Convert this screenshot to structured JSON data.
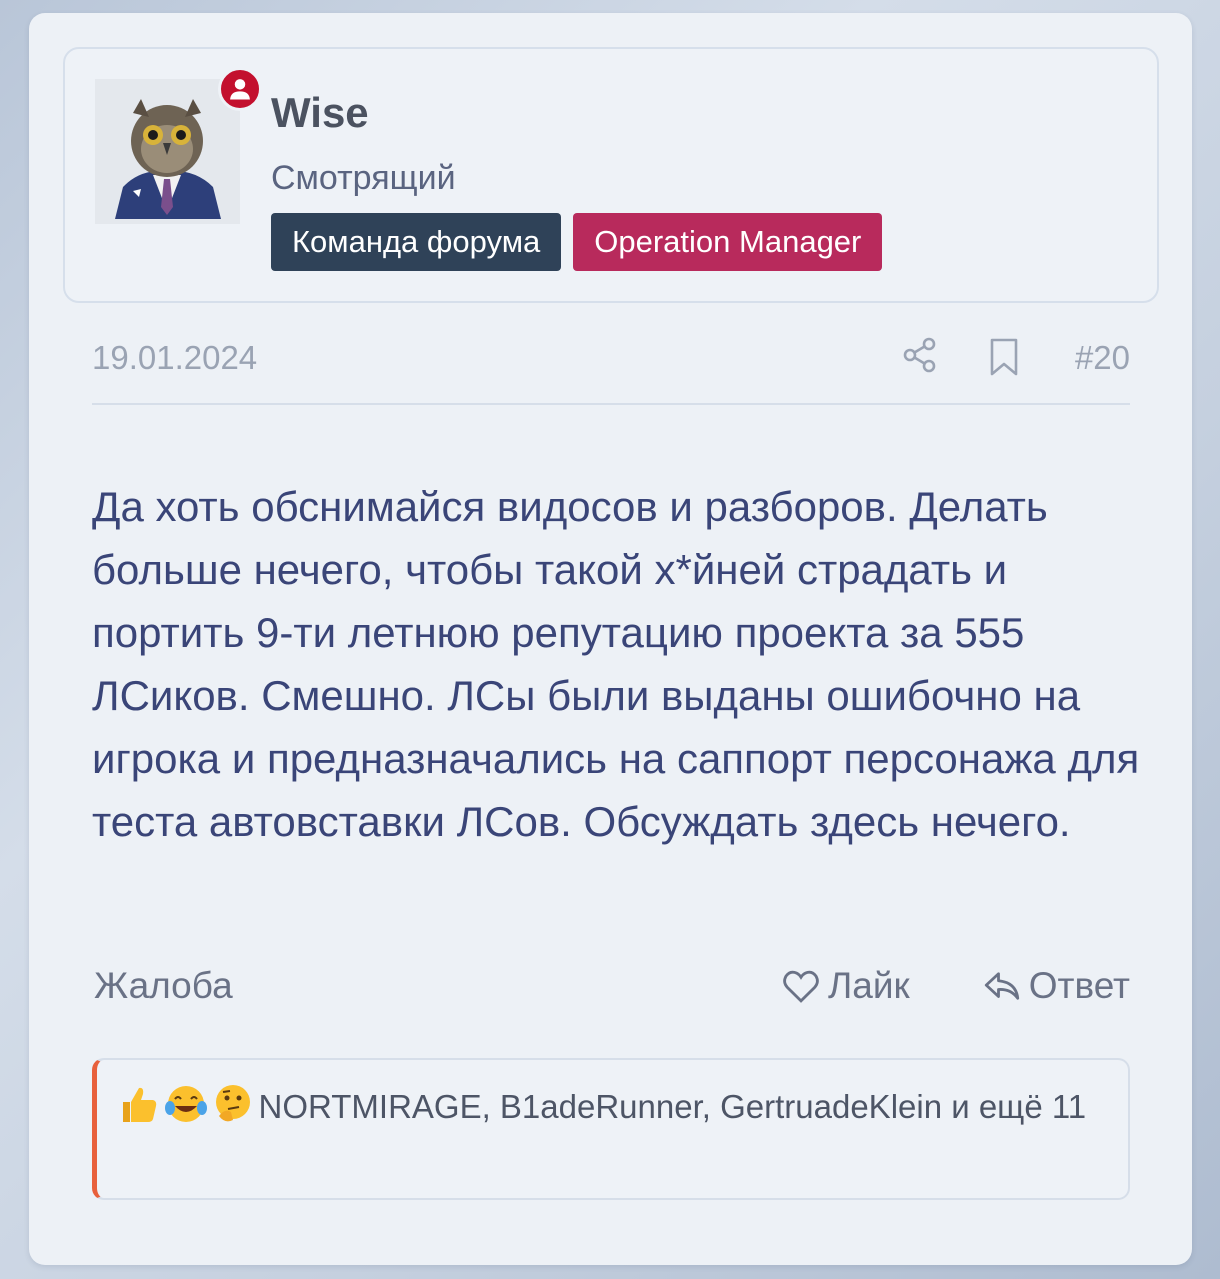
{
  "user": {
    "name": "Wise",
    "title": "Смотрящий",
    "badges": [
      "Команда форума",
      "Operation Manager"
    ],
    "avatar": "owl-in-suit"
  },
  "post": {
    "date": "19.01.2024",
    "number": "#20",
    "message": "Да хоть обснимайся видосов и разборов. Делать больше нечего, чтобы такой х*йней страдать и портить 9-ти летнюю репутацию проекта за 555 ЛСиков. Смешно. ЛСы были выданы ошибочно на игрока и предназначались на саппорт персонажа для теста автовставки ЛСов. Обсуждать здесь нечего."
  },
  "actions": {
    "report": "Жалоба",
    "like": "Лайк",
    "reply": "Ответ"
  },
  "reactions": {
    "emojis": [
      "thumbs-up",
      "crying-laughing",
      "thinking"
    ],
    "text": "NORTMIRAGE, B1adeRunner, GertruadeKlein и ещё 11"
  },
  "colors": {
    "badge_team": "#2f4258",
    "badge_operation": "#b82a5c",
    "status_dot": "#c3102e",
    "reaction_accent": "#e8603c",
    "message_text": "#3a4578"
  }
}
